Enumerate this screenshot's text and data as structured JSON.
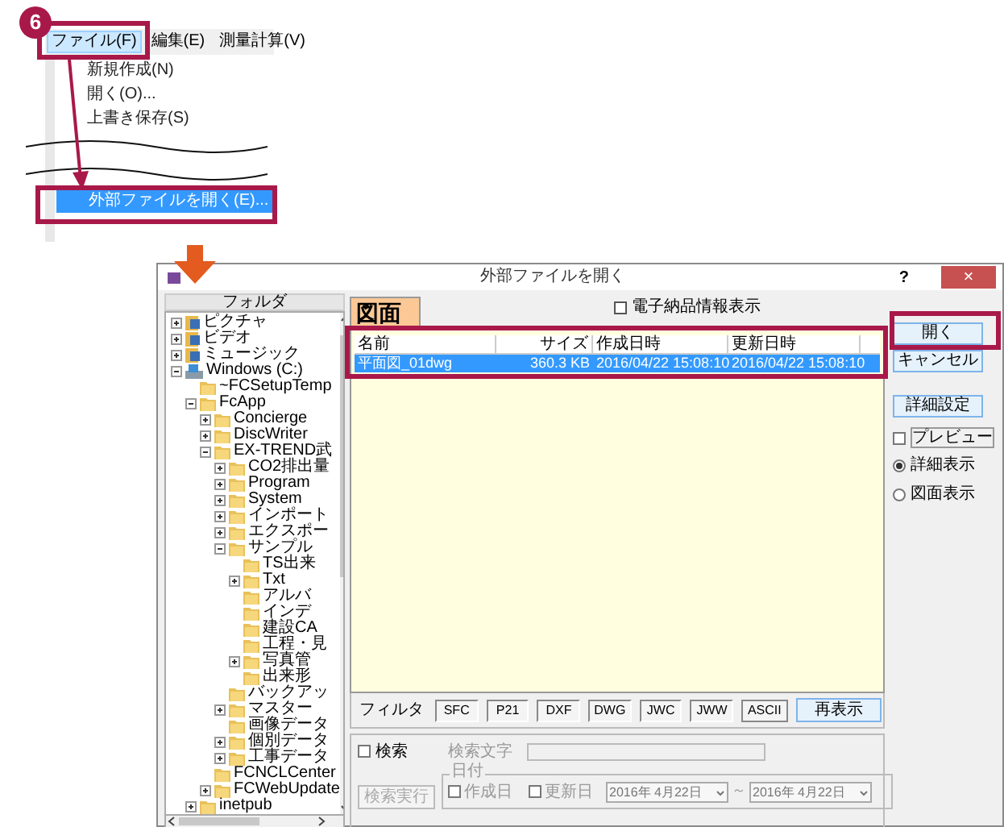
{
  "step_badge": "6",
  "menu": {
    "bar": [
      {
        "label": "ファイル(F)",
        "selected": true
      },
      {
        "label": "編集(E)",
        "selected": false
      },
      {
        "label": "測量計算(V)",
        "selected": false
      }
    ],
    "entries": [
      {
        "kind": "item",
        "label": "新規作成(N)",
        "selected": false
      },
      {
        "kind": "item",
        "label": "開く(O)...",
        "selected": false
      },
      {
        "kind": "item",
        "label": "上書き保存(S)",
        "selected": false
      },
      {
        "kind": "tear"
      },
      {
        "kind": "item",
        "label": "外部ファイルを開く(E)...",
        "selected": true
      }
    ]
  },
  "dialog": {
    "title": "外部ファイルを開く",
    "help": "?",
    "close": "×",
    "folder_header": "フォルダ",
    "tree": [
      {
        "label": "ピクチャ",
        "kind": "library",
        "expandable": true,
        "expanded": false
      },
      {
        "label": "ビデオ",
        "kind": "library",
        "expandable": true,
        "expanded": false
      },
      {
        "label": "ミュージック",
        "kind": "library",
        "expandable": true,
        "expanded": false
      },
      {
        "label": "Windows (C:)",
        "kind": "drive",
        "expandable": true,
        "expanded": true,
        "children": [
          {
            "label": "~FCSetupTemp",
            "kind": "folder",
            "expandable": false
          },
          {
            "label": "FcApp",
            "kind": "folder",
            "expandable": true,
            "expanded": true,
            "children": [
              {
                "label": "Concierge",
                "kind": "folder",
                "expandable": true,
                "expanded": false
              },
              {
                "label": "DiscWriter",
                "kind": "folder",
                "expandable": true,
                "expanded": false
              },
              {
                "label": "EX-TREND武",
                "kind": "folder",
                "expandable": true,
                "expanded": true,
                "children": [
                  {
                    "label": "CO2排出量",
                    "kind": "folder",
                    "expandable": true,
                    "expanded": false
                  },
                  {
                    "label": "Program",
                    "kind": "folder",
                    "expandable": true,
                    "expanded": false
                  },
                  {
                    "label": "System",
                    "kind": "folder",
                    "expandable": true,
                    "expanded": false
                  },
                  {
                    "label": "インポート",
                    "kind": "folder",
                    "expandable": true,
                    "expanded": false
                  },
                  {
                    "label": "エクスポー",
                    "kind": "folder",
                    "expandable": true,
                    "expanded": false
                  },
                  {
                    "label": "サンプル",
                    "kind": "folder",
                    "expandable": true,
                    "expanded": true,
                    "children": [
                      {
                        "label": "TS出来",
                        "kind": "folder",
                        "expandable": false
                      },
                      {
                        "label": "Txt",
                        "kind": "folder",
                        "expandable": true,
                        "expanded": false
                      },
                      {
                        "label": "アルバ",
                        "kind": "folder",
                        "expandable": false
                      },
                      {
                        "label": "インデ",
                        "kind": "folder",
                        "expandable": false
                      },
                      {
                        "label": "建設CA",
                        "kind": "folder",
                        "expandable": false
                      },
                      {
                        "label": "工程・見",
                        "kind": "folder",
                        "expandable": false
                      },
                      {
                        "label": "写真管",
                        "kind": "folder",
                        "expandable": true,
                        "expanded": false
                      },
                      {
                        "label": "出来形",
                        "kind": "folder",
                        "expandable": false
                      }
                    ]
                  },
                  {
                    "label": "バックアッ",
                    "kind": "folder",
                    "expandable": false
                  },
                  {
                    "label": "マスター",
                    "kind": "folder",
                    "expandable": true,
                    "expanded": false
                  },
                  {
                    "label": "画像データ",
                    "kind": "folder",
                    "expandable": false
                  },
                  {
                    "label": "個別データ",
                    "kind": "folder",
                    "expandable": true,
                    "expanded": false
                  },
                  {
                    "label": "工事データ",
                    "kind": "folder",
                    "expandable": true,
                    "expanded": false
                  }
                ]
              },
              {
                "label": "FCNCLCenter",
                "kind": "folder",
                "expandable": false
              },
              {
                "label": "FCWebUpdate",
                "kind": "folder",
                "expandable": true,
                "expanded": false
              }
            ]
          },
          {
            "label": "inetpub",
            "kind": "folder",
            "expandable": true,
            "expanded": false
          }
        ]
      }
    ],
    "tab": {
      "label": "図面",
      "selected": true
    },
    "info_checkbox": {
      "label": "電子納品情報表示",
      "checked": false
    },
    "columns": [
      "名前",
      "サイズ",
      "作成日時",
      "更新日時"
    ],
    "rows": [
      {
        "cells": [
          "平面図_01dwg",
          "360.3 KB",
          "2016/04/22 15:08:10",
          "2016/04/22 15:08:10"
        ],
        "selected": true
      }
    ],
    "filter_label": "フィルタ",
    "filters": [
      "SFC",
      "P21",
      "DXF",
      "DWG",
      "JWC",
      "JWW"
    ],
    "ascii": "ASCII",
    "refresh": "再表示",
    "search": {
      "checkbox": {
        "label": "検索",
        "checked": false
      },
      "text_label": "検索文字",
      "run": {
        "label": "検索実行",
        "disabled": true
      },
      "date_group": "日付",
      "created": {
        "label": "作成日",
        "checked": false
      },
      "updated": {
        "label": "更新日",
        "checked": false
      },
      "from": "2016年 4月22日",
      "tilde": "～",
      "to": "2016年 4月22日"
    },
    "side_buttons": [
      "開く",
      "キャンセル",
      "詳細設定"
    ],
    "preview": {
      "label": "プレビュー",
      "checked": false
    },
    "views": [
      {
        "label": "詳細表示",
        "selected": true
      },
      {
        "label": "図面表示",
        "selected": false
      }
    ]
  }
}
